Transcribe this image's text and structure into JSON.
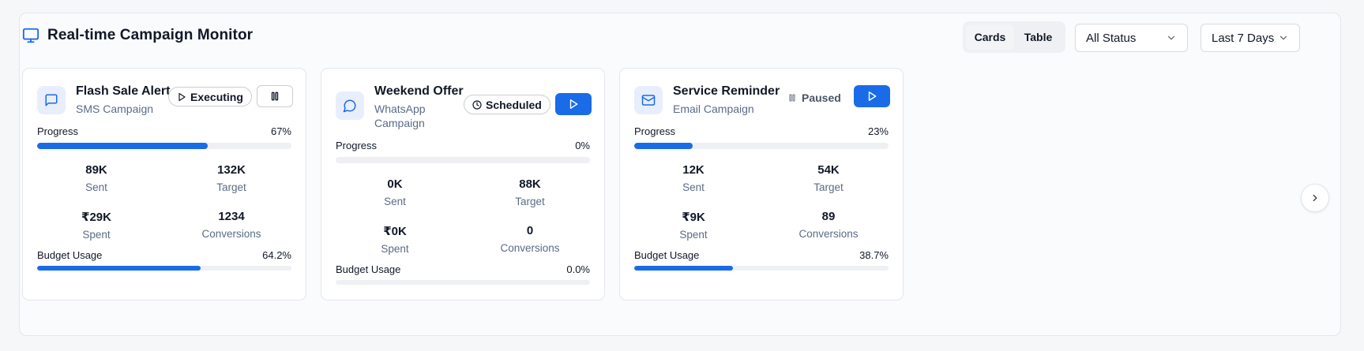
{
  "header": {
    "title": "Real-time Campaign Monitor",
    "icon": "monitor-icon"
  },
  "view_toggle": {
    "options": [
      "Cards",
      "Table"
    ],
    "selected": "Cards"
  },
  "filters": {
    "status": "All Status",
    "range": "Last 7 Days"
  },
  "colors": {
    "accent": "#1a6be8",
    "track": "#eef0f3",
    "muted": "#5b6b86"
  },
  "labels": {
    "progress": "Progress",
    "budget": "Budget Usage",
    "sent": "Sent",
    "target": "Target",
    "spent": "Spent",
    "conversions": "Conversions"
  },
  "campaigns": [
    {
      "name": "Flash Sale Alert",
      "type": "SMS Campaign",
      "type_icon": "chat-icon",
      "status": "Executing",
      "status_icon": "play-icon",
      "action": "pause",
      "progress": 67,
      "progress_label": "67%",
      "sent": "89K",
      "target": "132K",
      "spent": "₹29K",
      "conversions": "1234",
      "budget": 64.2,
      "budget_label": "64.2%"
    },
    {
      "name": "Weekend Offer",
      "type": "WhatsApp Campaign",
      "type_icon": "whatsapp-icon",
      "status": "Scheduled",
      "status_icon": "clock-icon",
      "action": "play",
      "progress": 0,
      "progress_label": "0%",
      "sent": "0K",
      "target": "88K",
      "spent": "₹0K",
      "conversions": "0",
      "budget": 0.0,
      "budget_label": "0.0%"
    },
    {
      "name": "Service Reminder",
      "type": "Email Campaign",
      "type_icon": "mail-icon",
      "status": "Paused",
      "status_icon": "pause-icon",
      "action": "play",
      "progress": 23,
      "progress_label": "23%",
      "sent": "12K",
      "target": "54K",
      "spent": "₹9K",
      "conversions": "89",
      "budget": 38.7,
      "budget_label": "38.7%"
    }
  ]
}
